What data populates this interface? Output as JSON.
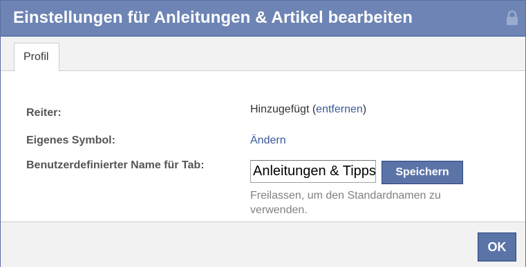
{
  "dialog": {
    "title": "Einstellungen für Anleitungen & Artikel bearbeiten",
    "header_color": "#6d84b4",
    "icons": {
      "title_right": "lock-icon"
    }
  },
  "tabs": [
    {
      "label": "Profil",
      "selected": true
    }
  ],
  "settings": {
    "reiter": {
      "label": "Reiter:",
      "status_text": "Hinzugefügt",
      "open_paren": "(",
      "action_link": "entfernen",
      "close_paren": ")"
    },
    "symbol": {
      "label": "Eigenes Symbol:",
      "action_link": "Ändern"
    },
    "custom_name": {
      "label": "Benutzerdefinierter Name für Tab:",
      "input_value": "Anleitungen & Tipps",
      "save_label": "Speichern",
      "hint": "Freilassen, um den Standardnamen zu verwenden."
    }
  },
  "footer": {
    "ok_label": "OK"
  },
  "colors": {
    "link": "#3b5998",
    "button": "#5b74a8"
  }
}
